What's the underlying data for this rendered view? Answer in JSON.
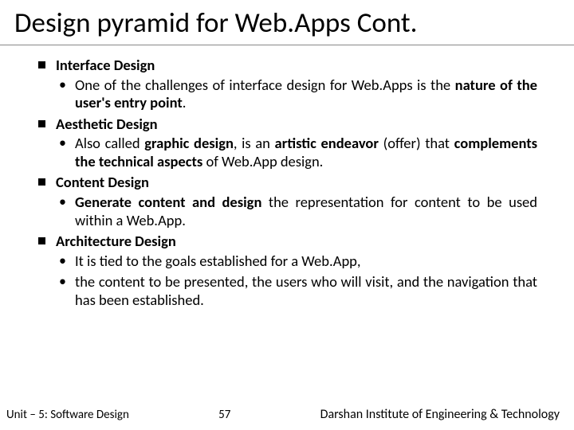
{
  "title": "Design pyramid for Web.Apps Cont.",
  "sections": {
    "s1": {
      "heading": "Interface Design",
      "p1a": "One of the challenges of interface design for Web.Apps is the ",
      "p1b": "nature of the user's entry point",
      "p1c": "."
    },
    "s2": {
      "heading": "Aesthetic Design",
      "p1a": "Also called ",
      "p1b": "graphic design",
      "p1c": ", is an ",
      "p1d": "artistic endeavor",
      "p1e": " (offer) that ",
      "p1f": "complements the technical aspects",
      "p1g": " of Web.App design."
    },
    "s3": {
      "heading": "Content Design",
      "p1a": "Generate content and design",
      "p1b": " the representation for content to be used within a Web.App."
    },
    "s4": {
      "heading": "Architecture Design",
      "p1": "It is tied to the goals established for a Web.App,",
      "p2": "the content to be presented, the users who will visit, and the navigation that has been established."
    }
  },
  "footer": {
    "unit": "Unit – 5: Software Design",
    "page": "57",
    "institute": "Darshan Institute of Engineering & Technology"
  }
}
